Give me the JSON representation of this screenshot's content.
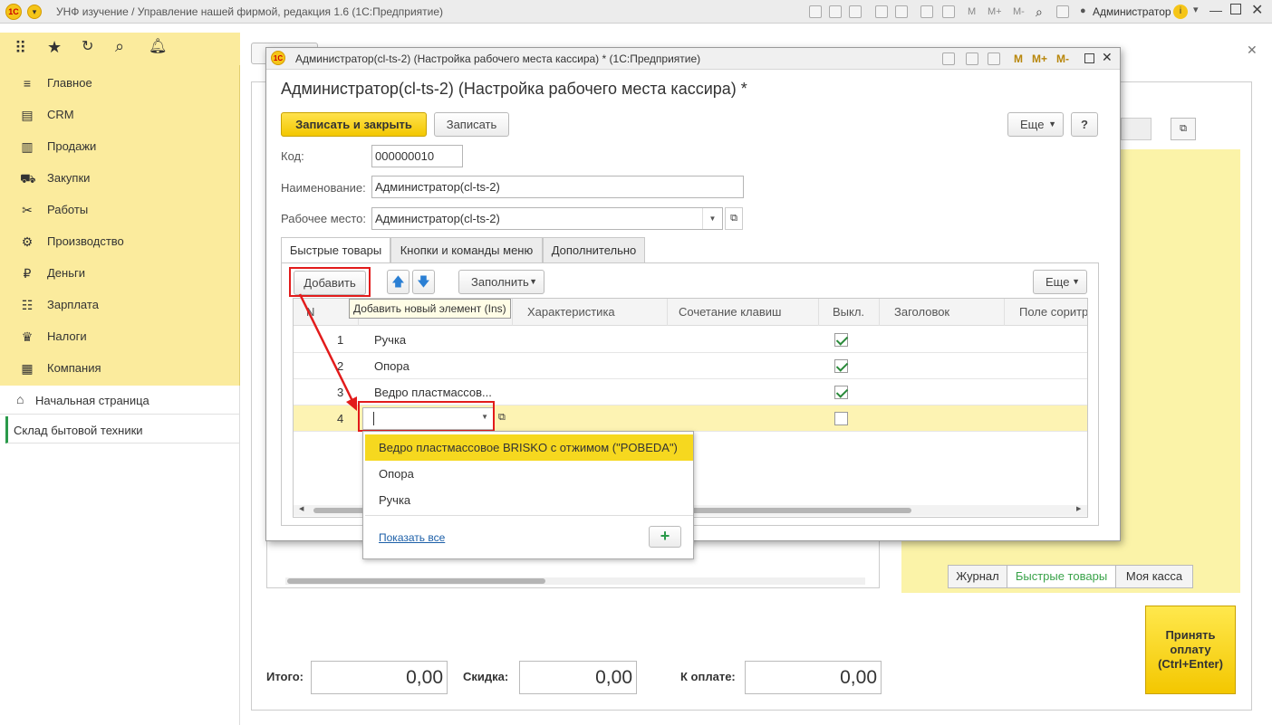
{
  "app": {
    "title": "УНФ изучение / Управление нашей фирмой, редакция 1.6  (1С:Предприятие)",
    "user": "Администратор",
    "logo": "1С",
    "toolbar_m": [
      "M",
      "M+",
      "M-"
    ]
  },
  "sidebar": {
    "sections": [
      {
        "label": "Главное",
        "icon": "menu-icon"
      },
      {
        "label": "CRM",
        "icon": "crm-icon"
      },
      {
        "label": "Продажи",
        "icon": "sales-icon"
      },
      {
        "label": "Закупки",
        "icon": "purchases-icon"
      },
      {
        "label": "Работы",
        "icon": "tools-icon"
      },
      {
        "label": "Производство",
        "icon": "factory-icon"
      },
      {
        "label": "Деньги",
        "icon": "ruble-icon"
      },
      {
        "label": "Зарплата",
        "icon": "salary-icon"
      },
      {
        "label": "Налоги",
        "icon": "taxes-icon"
      },
      {
        "label": "Компания",
        "icon": "company-icon"
      }
    ],
    "open_pages": [
      {
        "label": "Начальная страница"
      },
      {
        "label": "Склад бытовой техники"
      }
    ]
  },
  "dialog": {
    "window_title": "Администратор(cl-ts-2) (Настройка рабочего места кассира) *  (1С:Предприятие)",
    "heading": "Администратор(cl-ts-2) (Настройка рабочего места кассира) *",
    "save_close_label": "Записать и закрыть",
    "save_label": "Записать",
    "more_label": "Еще",
    "help_label": "?",
    "fields": {
      "code_label": "Код:",
      "code_value": "000000010",
      "name_label": "Наименование:",
      "name_value": "Администратор(cl-ts-2)",
      "workplace_label": "Рабочее место:",
      "workplace_value": "Администратор(cl-ts-2)"
    },
    "tabs": [
      "Быстрые товары",
      "Кнопки и команды меню",
      "Дополнительно"
    ],
    "table_toolbar": {
      "add_label": "Добавить",
      "fill_label": "Заполнить",
      "more_label": "Еще",
      "tooltip": "Добавить новый элемент (Ins)"
    },
    "columns": [
      "N",
      "Характеристика",
      "Сочетание клавиш",
      "Выкл.",
      "Заголовок",
      "Поле соритро"
    ],
    "rows": [
      {
        "n": "1",
        "product": "Ручка",
        "off": true
      },
      {
        "n": "2",
        "product": "Опора",
        "off": true
      },
      {
        "n": "3",
        "product": "Ведро пластмассов...",
        "off": true
      },
      {
        "n": "4",
        "product": "",
        "off": false
      }
    ],
    "dropdown": {
      "items": [
        "Ведро пластмассовое BRISKO с отжимом (\"POBEDA\")",
        "Опора",
        "Ручка"
      ],
      "show_all": "Показать все",
      "add_icon": "plus-icon"
    }
  },
  "background": {
    "tabs": [
      "Журнал",
      "Быстрые товары",
      "Моя касса"
    ],
    "totals": {
      "total_label": "Итого:",
      "total_value": "0,00",
      "discount_label": "Скидка:",
      "discount_value": "0,00",
      "due_label": "К оплате:",
      "due_value": "0,00"
    },
    "pay_button": "Принять оплату (Ctrl+Enter)"
  },
  "colors": {
    "accent_yellow": "#fbeb9d",
    "button_yellow": "#f3c700",
    "highlight_red": "#e21b1b",
    "selection_yellow": "#fdf3b3"
  }
}
